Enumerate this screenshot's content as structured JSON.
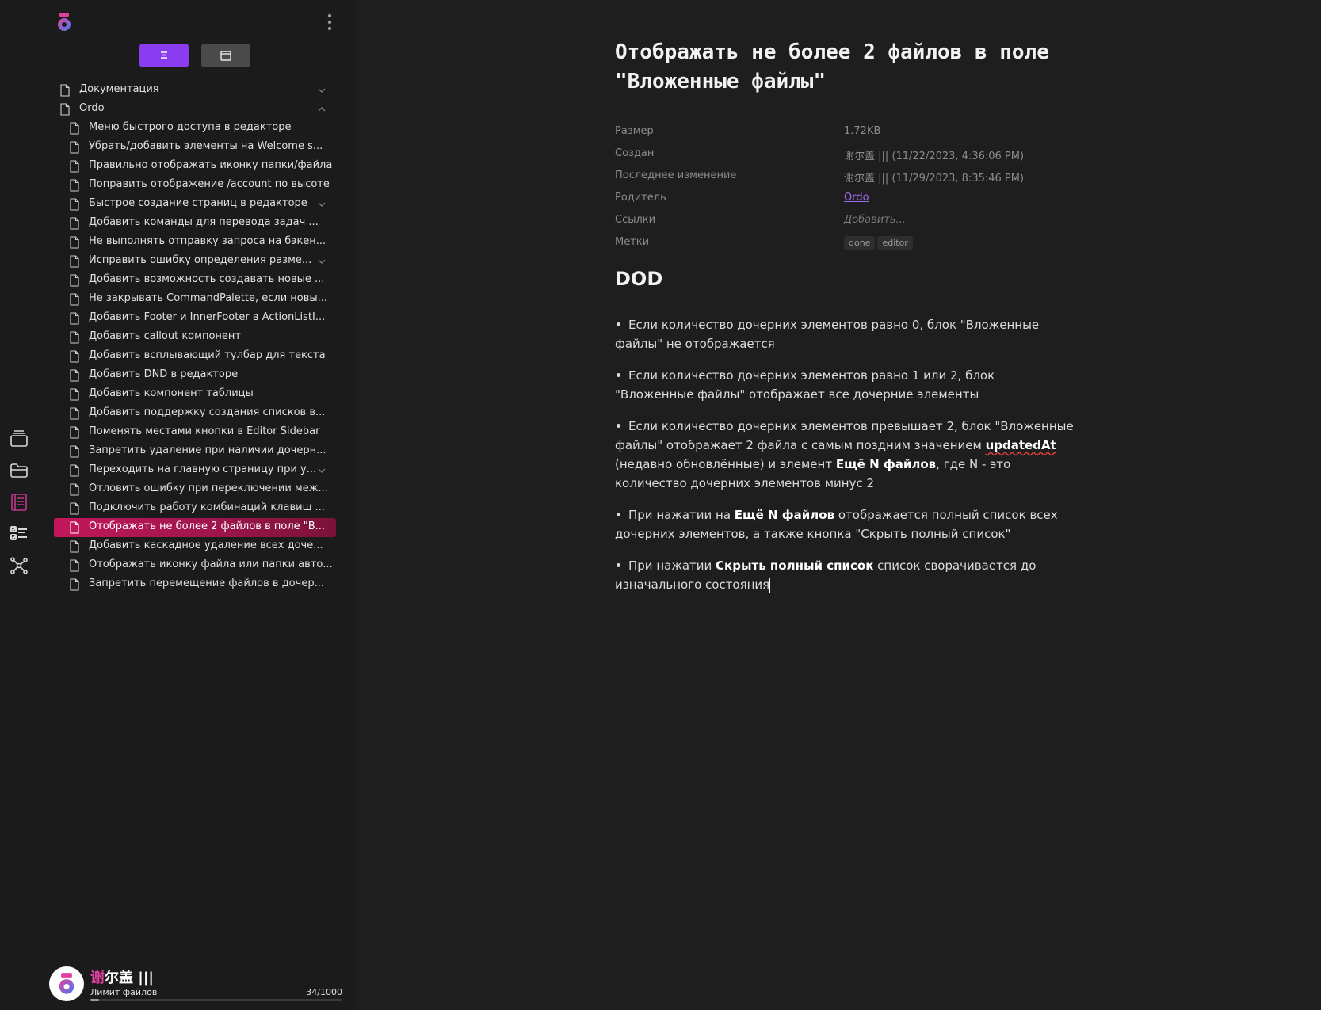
{
  "app": {
    "accent": "#8a3df0",
    "selection": "#c2185b"
  },
  "activity_bar": {
    "items": [
      {
        "name": "layers-icon",
        "active": false
      },
      {
        "name": "folder-icon",
        "active": false
      },
      {
        "name": "notebook-icon",
        "active": true
      },
      {
        "name": "checklist-icon",
        "active": false
      },
      {
        "name": "graph-icon",
        "active": false
      }
    ]
  },
  "sidebar": {
    "tree": [
      {
        "label": "Документация",
        "level": 0,
        "chevron": "down"
      },
      {
        "label": "Ordo",
        "level": 0,
        "chevron": "up"
      },
      {
        "label": "Меню быстрого доступа в редакторе",
        "level": 1
      },
      {
        "label": "Убрать/добавить элементы на Welcome s...",
        "level": 1
      },
      {
        "label": "Правильно отображать иконку папки/файла",
        "level": 1
      },
      {
        "label": "Поправить отображение /account по высоте",
        "level": 1
      },
      {
        "label": "Быстрое создание страниц в редакторе",
        "level": 1,
        "chevron": "down"
      },
      {
        "label": "Добавить команды для перевода задач ...",
        "level": 1
      },
      {
        "label": "Не выполнять отправку запроса на бэкен...",
        "level": 1
      },
      {
        "label": "Исправить ошибку определения разме...",
        "level": 1,
        "chevron": "down"
      },
      {
        "label": "Добавить возможность создавать новые ...",
        "level": 1
      },
      {
        "label": "Не закрывать CommandPalette, если новы...",
        "level": 1
      },
      {
        "label": "Добавить Footer и InnerFooter в ActionListI...",
        "level": 1
      },
      {
        "label": "Добавить callout компонент",
        "level": 1
      },
      {
        "label": "Добавить всплывающий тулбар для текста",
        "level": 1
      },
      {
        "label": "Добавить DND в редакторе",
        "level": 1
      },
      {
        "label": "Добавить компонент таблицы",
        "level": 1
      },
      {
        "label": "Добавить поддержку создания списков в...",
        "level": 1
      },
      {
        "label": "Поменять местами кнопки в Editor Sidebar",
        "level": 1
      },
      {
        "label": "Запретить удаление при наличии дочерн...",
        "level": 1
      },
      {
        "label": "Переходить на главную страницу при у...",
        "level": 1,
        "chevron": "down"
      },
      {
        "label": "Отловить ошибку при переключении меж...",
        "level": 1
      },
      {
        "label": "Подключить работу комбинаций клавиш ...",
        "level": 1
      },
      {
        "label": "Отображать не более 2 файлов в поле \"В...",
        "level": 1,
        "selected": true
      },
      {
        "label": "Добавить каскадное удаление всех доче...",
        "level": 1
      },
      {
        "label": "Отображать иконку файла или папки авто...",
        "level": 1
      },
      {
        "label": "Запретить перемещение файлов в дочер...",
        "level": 1
      }
    ],
    "user": {
      "name_hl": "谢",
      "name_rest": "尔盖 |||",
      "limit_label": "Лимит файлов",
      "limit_count": "34/1000",
      "limit_fraction": 0.034
    }
  },
  "doc": {
    "title": "Отображать не более 2 файлов в поле \"Вложенные файлы\"",
    "meta": [
      {
        "key": "Размер",
        "value": "1.72KB"
      },
      {
        "key": "Создан",
        "value": "谢尔盖 ||| (11/22/2023, 4:36:06 PM)"
      },
      {
        "key": "Последнее изменение",
        "value": "谢尔盖 ||| (11/29/2023, 8:35:46 PM)"
      },
      {
        "key": "Родитель",
        "value": "Ordo",
        "type": "link"
      },
      {
        "key": "Ссылки",
        "value": "Добавить...",
        "type": "placeholder"
      },
      {
        "key": "Метки",
        "tags": [
          "done",
          "editor"
        ]
      }
    ],
    "heading": "DOD",
    "bullets": {
      "b1": "Если количество дочерних элементов равно 0, блок \"Вложенные файлы\" не отображается",
      "b2": "Если количество дочерних элементов равно 1 или 2, блок \"Вложенные файлы\" отображает все дочерние элементы",
      "b3_a": "Если количество дочерних элементов превышает 2, блок \"Вложенные файлы\" отображает 2 файла с самым поздним значением ",
      "b3_bold1": "updatedAt",
      "b3_b": " (недавно обновлённые) и элемент ",
      "b3_bold2": "Ещё N файлов",
      "b3_c": ", где N - это количество дочерних элементов минус 2",
      "b4_a": "При нажатии на ",
      "b4_bold": "Ещё N файлов",
      "b4_b": " отображается полный список всех дочерних элементов, а также кнопка \"Скрыть полный список\"",
      "b5_a": "При нажатии ",
      "b5_bold": "Скрыть полный список",
      "b5_b": " список сворачивается до изначального состояния"
    }
  }
}
